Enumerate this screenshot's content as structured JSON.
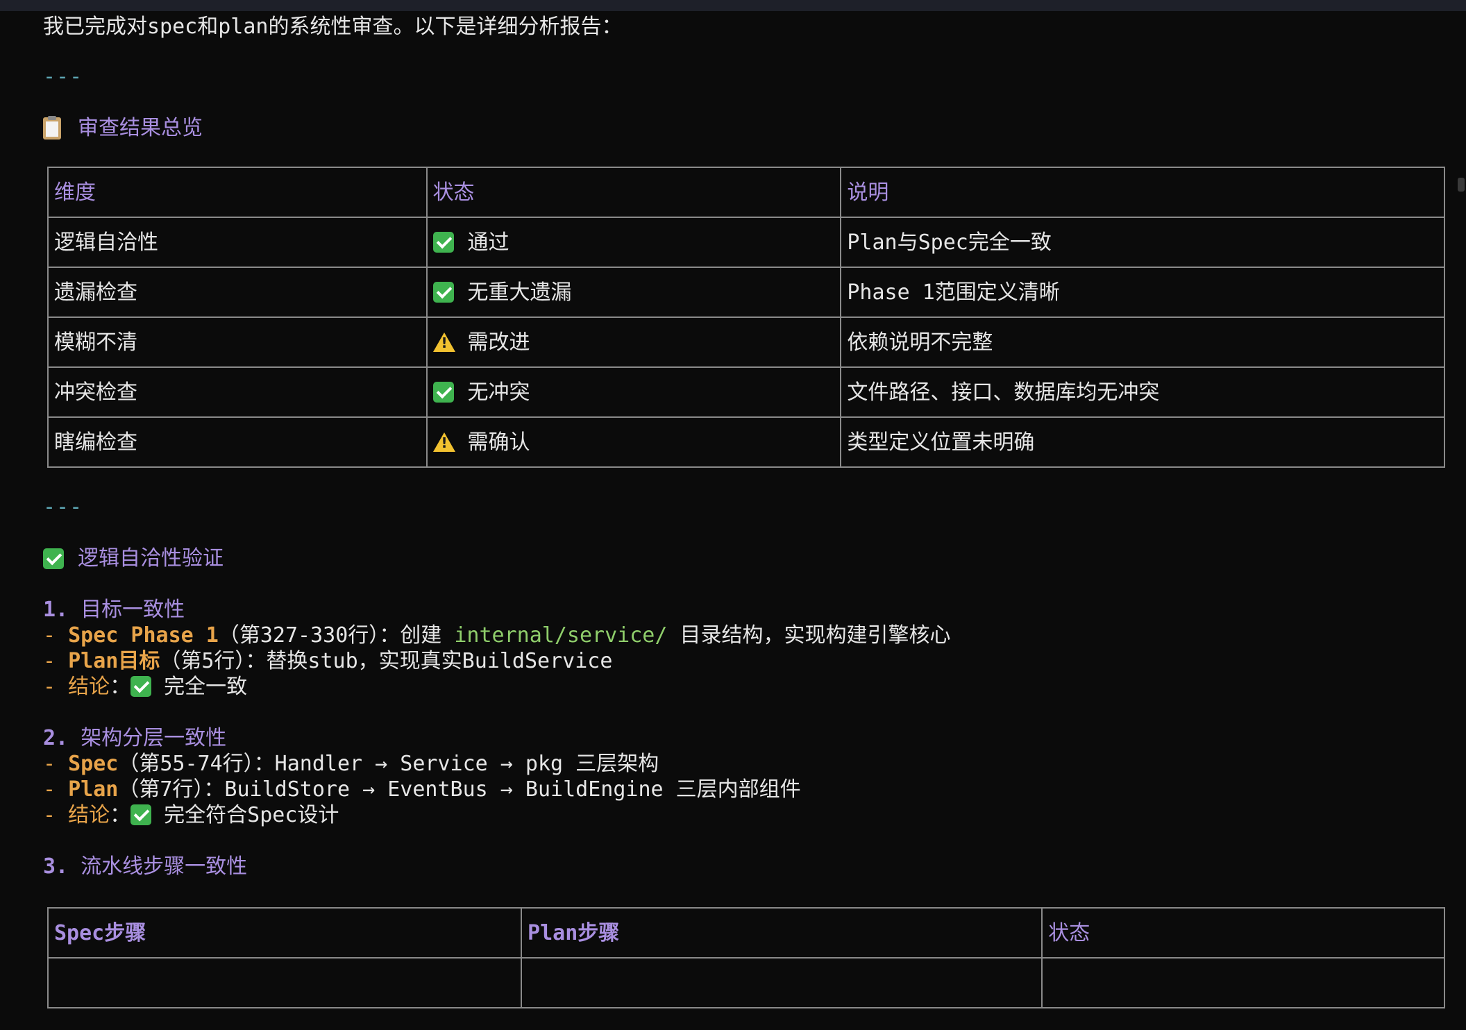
{
  "intro": "我已完成对spec和plan的系统性审查。以下是详细分析报告：",
  "hr": "---",
  "overview": {
    "icon": "clipboard-icon",
    "title": "审查结果总览",
    "headers": [
      "维度",
      "状态",
      "说明"
    ],
    "rows": [
      {
        "dim": "逻辑自洽性",
        "status_icon": "check-icon",
        "status": "通过",
        "note": "Plan与Spec完全一致"
      },
      {
        "dim": "遗漏检查",
        "status_icon": "check-icon",
        "status": "无重大遗漏",
        "note": "Phase 1范围定义清晰"
      },
      {
        "dim": "模糊不清",
        "status_icon": "warning-icon",
        "status": "需改进",
        "note": "依赖说明不完整"
      },
      {
        "dim": "冲突检查",
        "status_icon": "check-icon",
        "status": "无冲突",
        "note": "文件路径、接口、数据库均无冲突"
      },
      {
        "dim": "瞎编检查",
        "status_icon": "warning-icon",
        "status": "需确认",
        "note": "类型定义位置未明确"
      }
    ]
  },
  "logic": {
    "icon": "check-icon",
    "title": "逻辑自洽性验证",
    "sections": [
      {
        "num": "1.",
        "title": "目标一致性",
        "lines": [
          {
            "kw": "Spec Phase 1",
            "rest": "（第327-330行）：创建 ",
            "path": "internal/service/",
            "tail": " 目录结构，实现构建引擎核心"
          },
          {
            "kw": "Plan目标",
            "rest": "（第5行）：替换stub，实现真实BuildService",
            "path": "",
            "tail": ""
          },
          {
            "kw": "结论",
            "rest": "：",
            "icon": "check-icon",
            "tail": " 完全一致"
          }
        ]
      },
      {
        "num": "2.",
        "title": "架构分层一致性",
        "lines": [
          {
            "kw": "Spec",
            "rest": "（第55-74行）：Handler → Service → pkg 三层架构",
            "path": "",
            "tail": ""
          },
          {
            "kw": "Plan",
            "rest": "（第7行）：BuildStore → EventBus → BuildEngine 三层内部组件",
            "path": "",
            "tail": ""
          },
          {
            "kw": "结论",
            "rest": "：",
            "icon": "check-icon",
            "tail": " 完全符合Spec设计"
          }
        ]
      },
      {
        "num": "3.",
        "title": "流水线步骤一致性"
      }
    ]
  },
  "pipeline_table": {
    "headers": [
      "Spec步骤",
      "Plan步骤",
      "状态"
    ]
  },
  "colors": {
    "background": "#0b0b0b",
    "heading": "#a98fe0",
    "keyword": "#e8a44a",
    "path": "#8fce6b",
    "rule": "#5fa8b6",
    "check": "#3fb34f",
    "warning": "#f2c230"
  }
}
